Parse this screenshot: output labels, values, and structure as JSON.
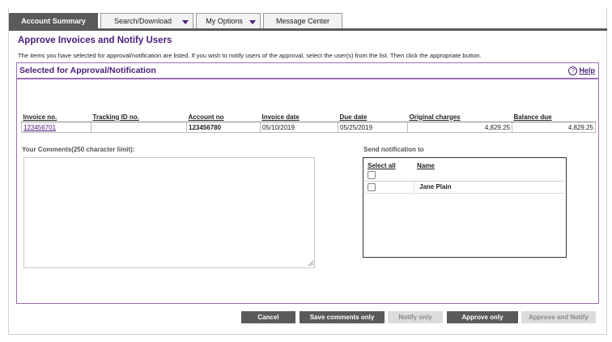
{
  "tabs": [
    {
      "label": "Account Summary",
      "has_menu": false,
      "active": true
    },
    {
      "label": "Search/Download",
      "has_menu": true,
      "active": false
    },
    {
      "label": "My Options",
      "has_menu": true,
      "active": false
    },
    {
      "label": "Message Center",
      "has_menu": false,
      "active": false
    }
  ],
  "page": {
    "title": "Approve Invoices and Notify Users",
    "intro": "The items you have selected for approval/notification are listed. If you wish to notify users of the approval, select the user(s) from the list. Then click the appropriate button."
  },
  "panel": {
    "title": "Selected for Approval/Notification",
    "help_label": "Help"
  },
  "invoice_table": {
    "headers": [
      "Invoice no.",
      "Tracking ID no.",
      "Account no",
      "Invoice date",
      "Due date",
      "Original charges",
      "Balance due"
    ],
    "rows": [
      [
        "123456701",
        "",
        "123456780",
        "05/10/2019",
        "05/25/2019",
        "4,829.25",
        "4,829.25"
      ]
    ]
  },
  "comments": {
    "label": "Your Comments(250 character limit):",
    "value": ""
  },
  "notify": {
    "label": "Send notification to",
    "select_all_label": "Select all",
    "name_header": "Name",
    "users": [
      {
        "name": "Jane Plain",
        "checked": false
      }
    ]
  },
  "buttons": {
    "cancel": "Cancel",
    "save_comments": "Save comments only",
    "notify_only": "Notify only",
    "approve_only": "Approve only",
    "approve_notify": "Approve and Notify"
  },
  "colors": {
    "accent_purple": "#4b1d7a",
    "panel_border": "#9b6fb7",
    "tab_dark": "#5a5a5a",
    "disabled_button": "#dcdcdc"
  }
}
